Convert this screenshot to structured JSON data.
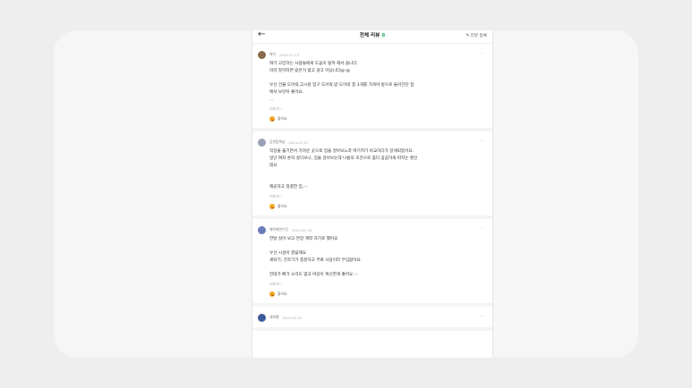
{
  "header": {
    "title": "전체 리뷰",
    "count": "8",
    "write_label": "리뷰 등록",
    "back_icon": "arrow-left-icon",
    "write_icon": "pencil-icon"
  },
  "reviews": [
    {
      "nickname": "케이",
      "date": "2025-01-13",
      "avatar_color": "#8a6a4a",
      "lines": [
        "여기 고민하는 사람들에게 도움이 될까 해서 씁니다.",
        "미리 말하자면 받은거 없고 광고 아닙니다@-@",
        "",
        "우선 건물 도어락,고시원 입구 도어락,방 도어락 총 3개를 거쳐야 방으로 들어간단 점",
        "에서 보안이 좋아요.",
        "..."
      ],
      "readmore": "더보기",
      "like_label": "좋아요"
    },
    {
      "nickname": "감빈탐책삼",
      "date": "2024-07-07",
      "avatar_color": "#9aa3b5",
      "lines": [
        "직장을 옮기면서 가까운 곳으로 집을 알아보느라 여기저기 비교하다가 알게되었어요.",
        "일단 여자 혼자 살다보니, 집을 알아보는데 나름의 조건으로 좀더 꼼꼼하게 따지는 편인",
        "데요",
        "",
        "",
        "깨끗하고 정결한 집,···"
      ],
      "readmore": "더보기",
      "like_label": "좋아요"
    },
    {
      "nickname": "매력제연수진",
      "date": "2024-05-16",
      "avatar_color": "#6b7bb8",
      "lines": [
        "한달 살아 보고 연장 계약 하기로 했어요",
        "",
        "우선 시설이 깔끔해요",
        "세탁기, 건조기가 충분하고 무료 사용이라 무딤없어요.",
        "",
        "전대가 빠가 소리도 없고 비당이 폭신한게 좋아요.···"
      ],
      "readmore": "더보기",
      "like_label": "좋아요"
    },
    {
      "nickname": "래퍼쨈",
      "date": "2024-03-24",
      "avatar_color": "#3d5a99",
      "lines": [],
      "readmore": "",
      "like_label": ""
    }
  ],
  "icons": {
    "more": "more-dots-icon",
    "like": "smile-icon"
  }
}
